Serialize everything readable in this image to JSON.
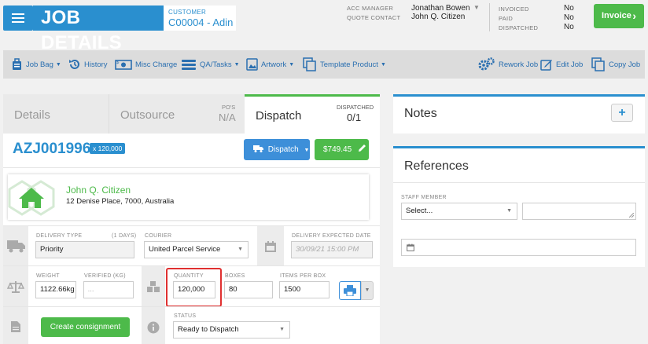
{
  "header": {
    "title": "JOB DETAILS",
    "customer_label": "CUSTOMER",
    "customer_value": "C00004 - Adin",
    "acc_manager_label": "ACC MANAGER",
    "acc_manager_value": "Jonathan Bowen",
    "quote_contact_label": "QUOTE CONTACT",
    "quote_contact_value": "John Q. Citizen",
    "invoiced_label": "INVOICED",
    "invoiced_value": "No",
    "paid_label": "PAID",
    "paid_value": "No",
    "dispatched_label": "DISPATCHED",
    "dispatched_value": "No",
    "invoice_button": "Invoice"
  },
  "toolbar": {
    "items": [
      {
        "label": "Job Bag",
        "icon": "bag-icon",
        "dropdown": true
      },
      {
        "label": "History",
        "icon": "history-icon",
        "dropdown": false
      },
      {
        "label": "Misc Charge",
        "icon": "money-icon",
        "dropdown": false
      },
      {
        "label": "QA/Tasks",
        "icon": "tasks-icon",
        "dropdown": true
      },
      {
        "label": "Artwork",
        "icon": "image-icon",
        "dropdown": true
      },
      {
        "label": "Template Product",
        "icon": "copy-icon",
        "dropdown": true
      }
    ],
    "right_items": [
      {
        "label": "Rework Job",
        "icon": "gears-icon"
      },
      {
        "label": "Edit Job",
        "icon": "edit-icon"
      },
      {
        "label": "Copy Job",
        "icon": "copy-icon"
      }
    ]
  },
  "tabs": {
    "details": "Details",
    "outsource": "Outsource",
    "pos_label": "PO'S",
    "pos_value": "N/A",
    "dispatch": "Dispatch",
    "dispatched_label": "DISPATCHED",
    "dispatched_value": "0/1"
  },
  "job": {
    "id": "AZJ001996",
    "qty_badge": "x 120,000",
    "dispatch_button": "Dispatch",
    "price_button": "$749.45"
  },
  "address": {
    "name": "John Q. Citizen",
    "line": "12 Denise Place, 7000, Australia"
  },
  "delivery": {
    "type_label": "DELIVERY TYPE",
    "days_label": "(1 DAYS)",
    "type_value": "Priority",
    "courier_label": "COURIER",
    "courier_value": "United Parcel Service",
    "expected_label": "DELIVERY EXPECTED DATE",
    "expected_placeholder": "30/09/21 15:00 PM"
  },
  "weights": {
    "weight_label": "WEIGHT",
    "weight_value": "1122.66kg",
    "verified_label": "VERIFIED (KG)",
    "verified_placeholder": "...",
    "quantity_label": "QUANTITY",
    "quantity_value": "120,000",
    "boxes_label": "BOXES",
    "boxes_value": "80",
    "items_label": "ITEMS PER BOX",
    "items_value": "1500"
  },
  "consignment": {
    "button": "Create consignment",
    "status_label": "STATUS",
    "status_value": "Ready to Dispatch"
  },
  "notes": {
    "title": "Notes",
    "add": "+"
  },
  "references": {
    "title": "References",
    "staff_label": "STAFF MEMBER",
    "staff_value": "Select..."
  },
  "colors": {
    "primary": "#2a8fcf",
    "success": "#4dba4a",
    "highlight": "#e03030"
  }
}
